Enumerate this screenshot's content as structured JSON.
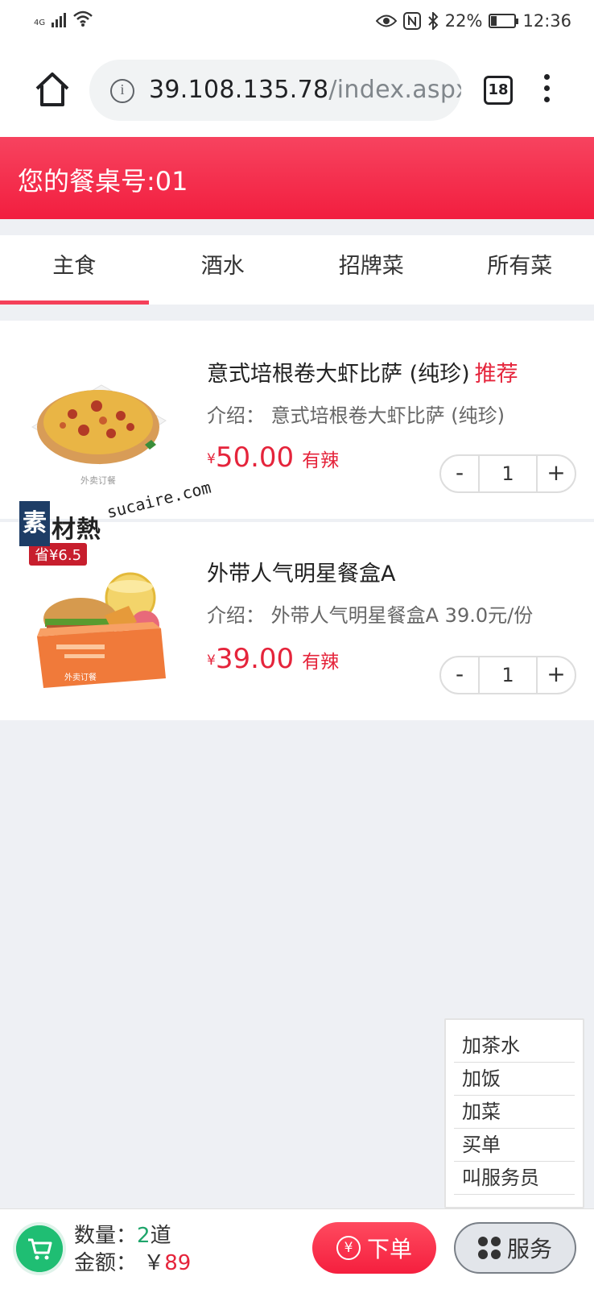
{
  "status_bar": {
    "network": "4G",
    "battery": "22%",
    "time": "12:36"
  },
  "browser": {
    "url_host": "39.108.135.78",
    "url_path": "/index.aspx",
    "tab_count": "18"
  },
  "header": {
    "title": "您的餐桌号:01"
  },
  "tabs": [
    {
      "label": "主食",
      "active": true
    },
    {
      "label": "酒水",
      "active": false
    },
    {
      "label": "招牌菜",
      "active": false
    },
    {
      "label": "所有菜",
      "active": false
    }
  ],
  "items": [
    {
      "name": "意式培根卷大虾比萨 (纯珍)",
      "badge": "推荐",
      "desc": "介绍：  意式培根卷大虾比萨 (纯珍)",
      "currency": "¥",
      "price": "50.00",
      "tag": "有辣",
      "qty": "1",
      "image_caption": "外卖订餐"
    },
    {
      "name": "外带人气明星餐盒A",
      "badge": "",
      "desc": "介绍：  外带人气明星餐盒A 39.0元/份",
      "currency": "¥",
      "price": "39.00",
      "tag": "有辣",
      "qty": "1",
      "image_badge": "省¥6.5",
      "image_caption": "外卖订餐"
    }
  ],
  "stepper": {
    "minus": "-",
    "plus": "+"
  },
  "watermark": {
    "box_char": "素",
    "chars": "材熱",
    "url": "sucaire.com"
  },
  "service_menu": {
    "items": [
      "加茶水",
      "加饭",
      "加菜",
      "买单",
      "叫服务员"
    ]
  },
  "bottom": {
    "count_label": "数量：",
    "count_value": "2",
    "count_unit": "道",
    "amount_label": "金额：  ￥",
    "amount_value": "89",
    "order_label": "下单",
    "order_icon": "¥",
    "service_label": "服务"
  },
  "colors": {
    "brand_red": "#f21e3f",
    "accent_green": "#1fbe73"
  }
}
